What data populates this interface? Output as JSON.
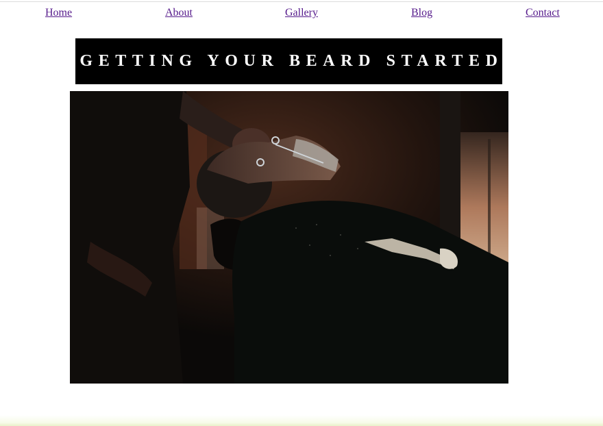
{
  "nav": {
    "home": "Home",
    "about": "About",
    "gallery": "Gallery",
    "blog": "Blog",
    "contact": "Contact"
  },
  "banner": {
    "title": "GETTING YOUR BEARD STARTED"
  },
  "colors": {
    "link": "#551a8b",
    "banner_bg": "#000000",
    "banner_text": "#ffffff"
  }
}
